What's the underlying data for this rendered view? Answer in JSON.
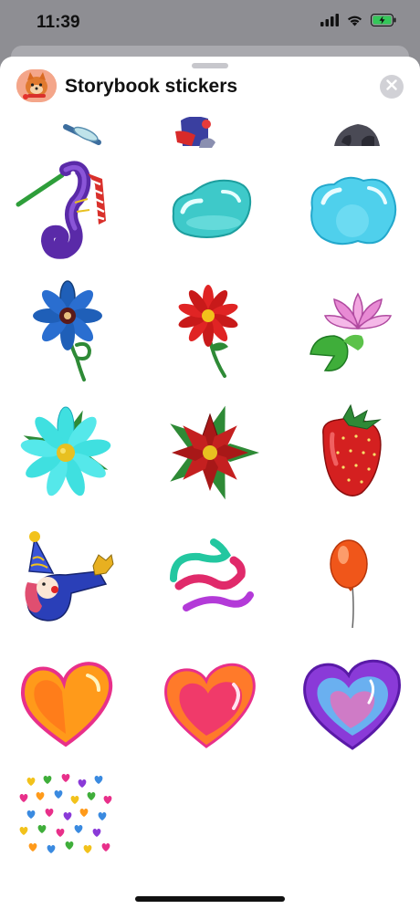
{
  "status_bar": {
    "time": "11:39",
    "icons": [
      "signal-icon",
      "wifi-icon",
      "battery-charging-icon"
    ]
  },
  "header": {
    "title": "Storybook stickers",
    "app_icon": "pomeranian-dog-icon",
    "close_icon": "close-icon"
  },
  "stickers": [
    {
      "name": "dragonfly-sticker",
      "partially_visible": true
    },
    {
      "name": "character-sticker",
      "partially_visible": true
    },
    {
      "name": "animal-sticker",
      "partially_visible": true
    },
    {
      "name": "seahorse-sticker"
    },
    {
      "name": "teal-gel-blob-sticker"
    },
    {
      "name": "blue-gel-blob-sticker"
    },
    {
      "name": "blue-flower-sticker"
    },
    {
      "name": "red-flower-sticker"
    },
    {
      "name": "water-lily-sticker"
    },
    {
      "name": "turquoise-flower-sticker"
    },
    {
      "name": "red-poinsettia-sticker"
    },
    {
      "name": "strawberry-sticker"
    },
    {
      "name": "clown-sticker"
    },
    {
      "name": "paint-swirls-sticker"
    },
    {
      "name": "orange-balloon-sticker"
    },
    {
      "name": "orange-heart-sticker"
    },
    {
      "name": "pink-heart-sticker"
    },
    {
      "name": "purple-blue-heart-sticker"
    },
    {
      "name": "confetti-hearts-sticker"
    }
  ],
  "colors": {
    "sheet_background": "#ffffff",
    "backdrop": "#8e8e93",
    "close_button": "#d1d1d6",
    "battery": "#34c759"
  }
}
